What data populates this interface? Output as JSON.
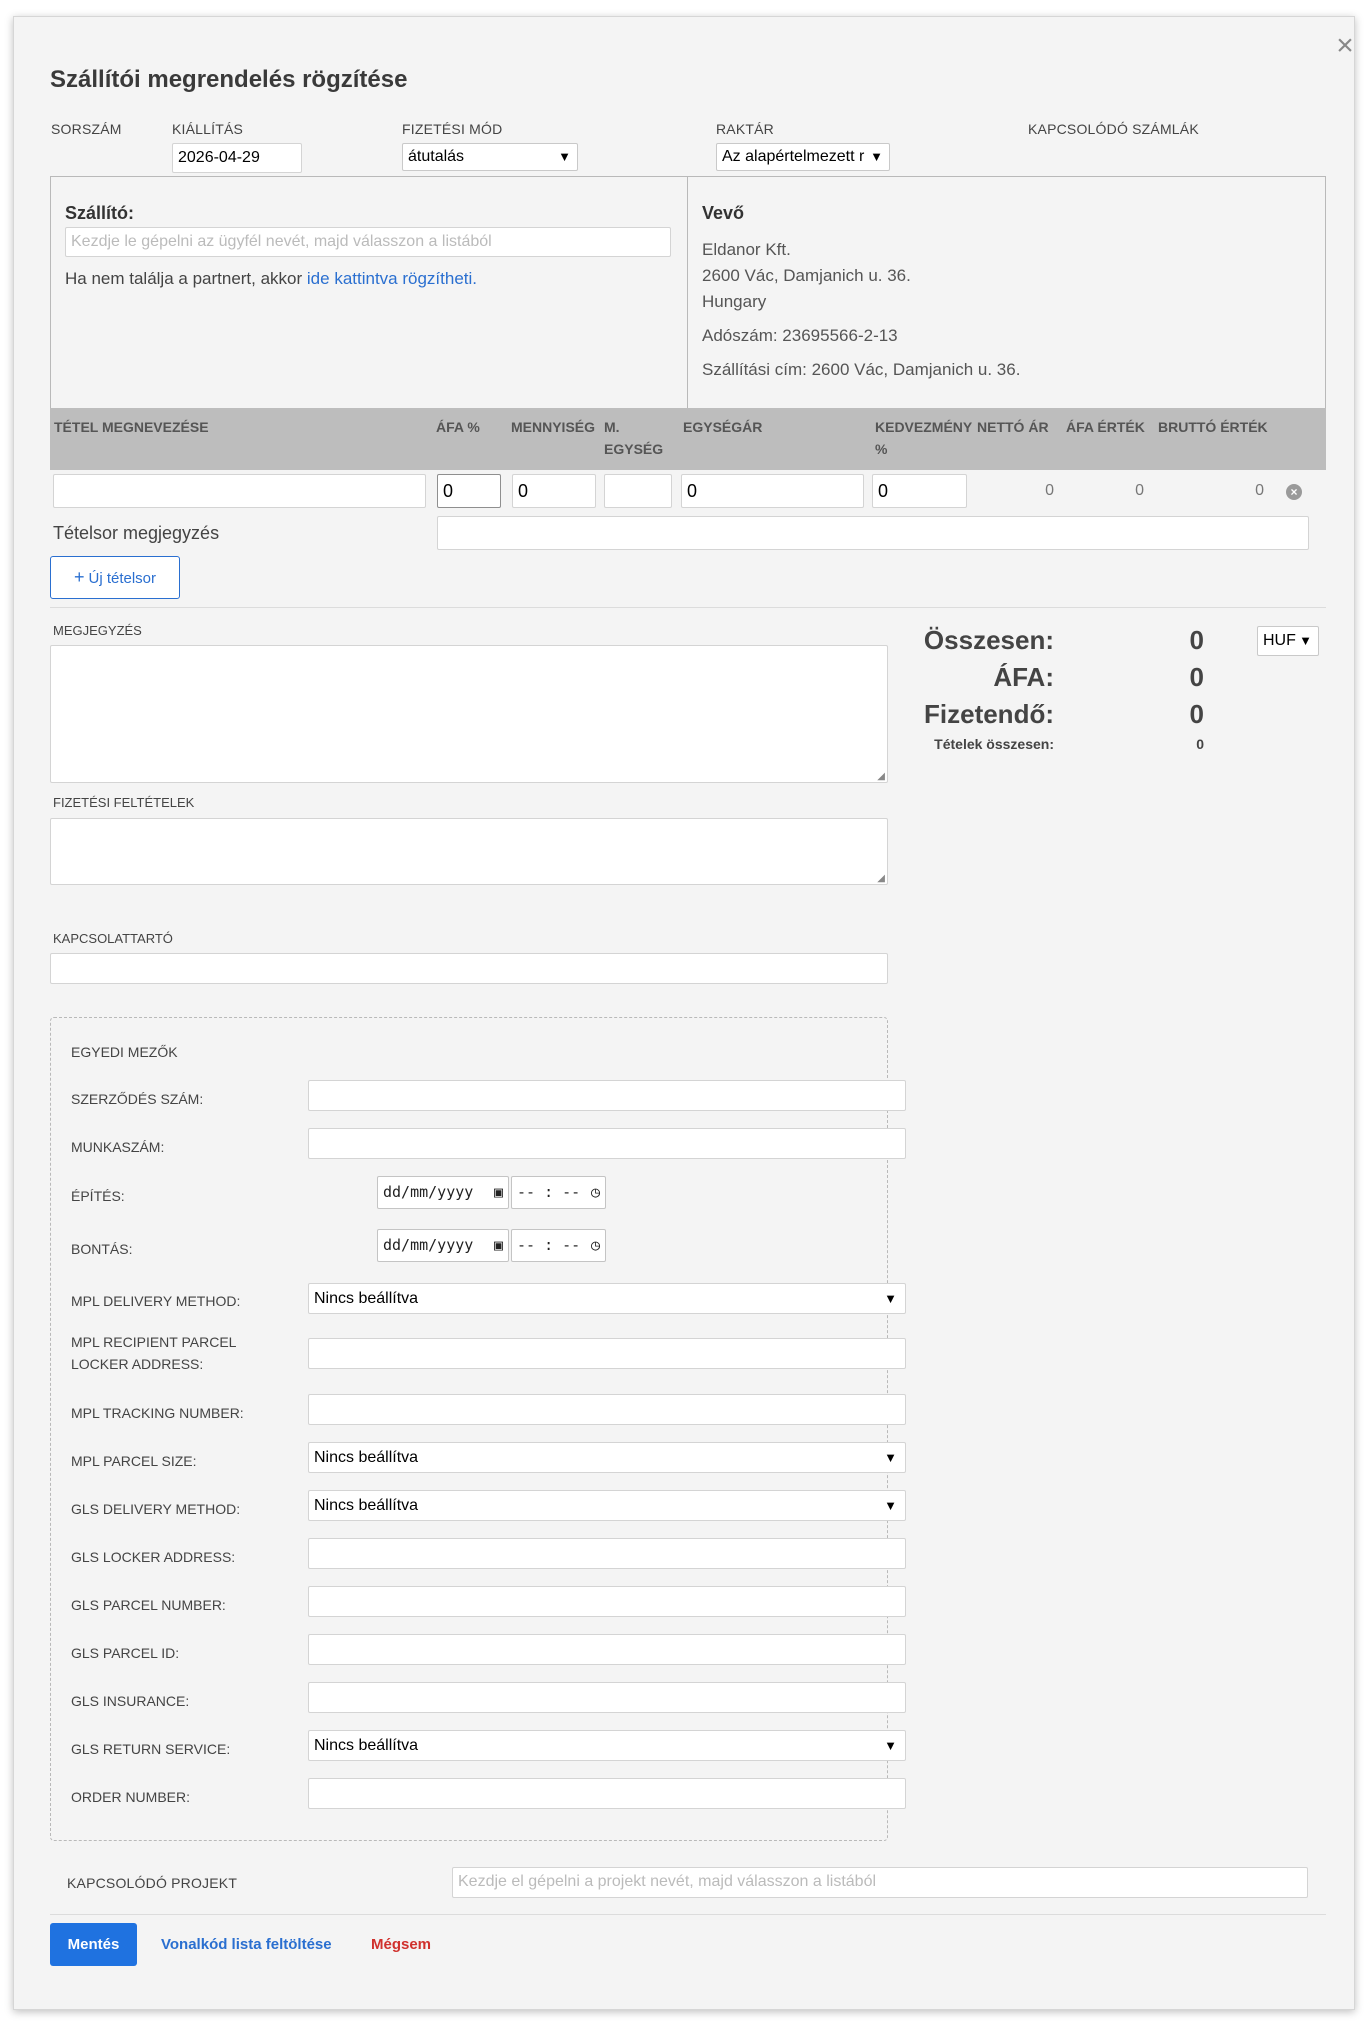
{
  "dialog": {
    "title": "Szállítói megrendelés rögzítése",
    "close_symbol": "×"
  },
  "header_fields": {
    "sorszam_label": "SORSZÁM",
    "kiallitas_label": "KIÁLLÍTÁS",
    "kiallitas_value": "2026-04-29",
    "fizetesi_mod_label": "FIZETÉSI MÓD",
    "fizetesi_mod_value": "átutalás",
    "raktar_label": "RAKTÁR",
    "raktar_value": "Az alapértelmezett r",
    "kapcsolodo_szamlak_label": "KAPCSOLÓDÓ SZÁMLÁK"
  },
  "supplier": {
    "label": "Szállító:",
    "placeholder": "Kezdje le gépelni az ügyfél nevét, majd válasszon a listából",
    "help_text": "Ha nem találja a partnert, akkor ",
    "help_link": "ide kattintva rögzítheti."
  },
  "buyer": {
    "label": "Vevő",
    "name": "Eldanor Kft.",
    "address": "2600 Vác, Damjanich u. 36.",
    "country": "Hungary",
    "tax": "Adószám: 23695566-2-13",
    "shipping": "Szállítási cím: 2600 Vác, Damjanich u. 36."
  },
  "table": {
    "headers": {
      "name": "TÉTEL MEGNEVEZÉSE",
      "vat": "ÁFA %",
      "qty": "MENNYISÉG",
      "unit_1": "M.",
      "unit_2": "EGYSÉG",
      "unit_price": "EGYSÉGÁR",
      "discount_1": "KEDVEZMÉNY",
      "discount_2": "%",
      "net": "NETTÓ ÁR",
      "vat_value": "ÁFA ÉRTÉK",
      "gross": "BRUTTÓ ÉRTÉK"
    },
    "row": {
      "vat": "0",
      "qty": "0",
      "unit_price": "0",
      "discount": "0",
      "net": "0",
      "vat_value": "0",
      "gross": "0"
    },
    "note_label": "Tételsor megjegyzés",
    "new_row_button": "Új tételsor"
  },
  "notes": {
    "megjegyzes_label": "MEGJEGYZÉS",
    "fizetesi_feltetelek_label": "FIZETÉSI FELTÉTELEK",
    "kapcsolattarto_label": "KAPCSOLATTARTÓ"
  },
  "totals": {
    "osszesen_label": "Összesen:",
    "osszesen_value": "0",
    "afa_label": "ÁFA:",
    "afa_value": "0",
    "fizetendo_label": "Fizetendő:",
    "fizetendo_value": "0",
    "tetelek_label": "Tételek összesen:",
    "tetelek_value": "0",
    "currency": "HUF"
  },
  "custom_fields": {
    "title": "EGYEDI MEZŐK",
    "szerzodes_szam": "SZERZŐDÉS SZÁM:",
    "munkaszam": "MUNKASZÁM:",
    "epites": "ÉPÍTÉS:",
    "bontas": "BONTÁS:",
    "date_placeholder": "dd/mm/yyyy",
    "time_placeholder": "-- : --",
    "mpl_delivery_method": "MPL DELIVERY METHOD:",
    "mpl_locker_1": "MPL RECIPIENT PARCEL",
    "mpl_locker_2": "LOCKER ADDRESS:",
    "mpl_tracking": "MPL TRACKING NUMBER:",
    "mpl_parcel_size": "MPL PARCEL SIZE:",
    "gls_delivery_method": "GLS DELIVERY METHOD:",
    "gls_locker_address": "GLS LOCKER ADDRESS:",
    "gls_parcel_number": "GLS PARCEL NUMBER:",
    "gls_parcel_id": "GLS PARCEL ID:",
    "gls_insurance": "GLS INSURANCE:",
    "gls_return_service": "GLS RETURN SERVICE:",
    "order_number": "ORDER NUMBER:",
    "not_set": "Nincs beállítva"
  },
  "project": {
    "label": "KAPCSOLÓDÓ PROJEKT",
    "placeholder": "Kezdje el gépelni a projekt nevét, majd válasszon a listából"
  },
  "footer": {
    "save": "Mentés",
    "barcode_upload": "Vonalkód lista feltöltése",
    "cancel": "Mégsem"
  },
  "icons": {
    "close": "close-icon",
    "plus": "plus-icon",
    "remove_row": "remove-circle-icon",
    "calendar": "calendar-icon",
    "clock": "clock-icon",
    "dropdown": "triangle-down-icon"
  },
  "colors": {
    "primary": "#1f72e0",
    "link": "#2a6fd0",
    "cancel": "#d0312d",
    "table_header": "#bdbdbd"
  }
}
